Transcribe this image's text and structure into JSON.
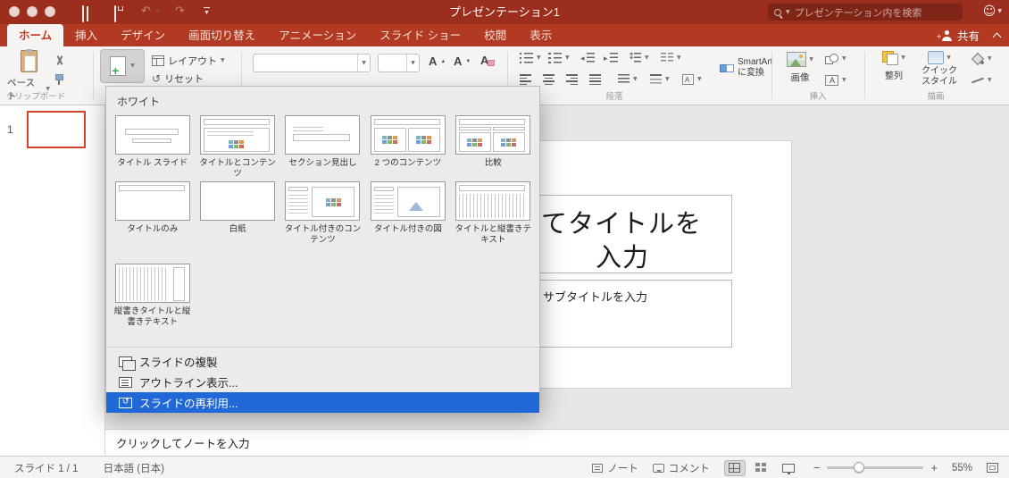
{
  "colors": {
    "titlebar": "#9c2e1e",
    "tabbar": "#b23a22",
    "tab_active_text": "#c03a22",
    "ribbon_bg": "#f5f4f3",
    "selection": "#2067d8",
    "slide_border": "#d2432c"
  },
  "titlebar": {
    "window_title": "プレゼンテーション1",
    "search_placeholder": "プレゼンテーション内を検索"
  },
  "tabs": [
    {
      "label": "ホーム",
      "active": true
    },
    {
      "label": "挿入"
    },
    {
      "label": "デザイン"
    },
    {
      "label": "画面切り替え"
    },
    {
      "label": "アニメーション"
    },
    {
      "label": "スライド ショー"
    },
    {
      "label": "校閲"
    },
    {
      "label": "表示"
    }
  ],
  "share": {
    "label": "共有"
  },
  "ribbon": {
    "paste": "ペースト",
    "clipboard_group": "クリップボード",
    "layout": "レイアウト",
    "reset": "リセット",
    "font_name_value": "",
    "font_size_value": "",
    "smartart_line1": "SmartArt",
    "smartart_line2": "に変換",
    "paragraph_group": "段落",
    "image": "画像",
    "insert_group": "挿入",
    "arrange": "整列",
    "quick_style_line1": "クイック",
    "quick_style_line2": "スタイル",
    "drawing_group": "描画"
  },
  "new_slide_menu": {
    "theme_header": "ホワイト",
    "layouts": [
      {
        "label": "タイトル スライド"
      },
      {
        "label": "タイトルとコンテンツ"
      },
      {
        "label": "セクション見出し"
      },
      {
        "label": "2 つのコンテンツ"
      },
      {
        "label": "比較"
      },
      {
        "label": "タイトルのみ"
      },
      {
        "label": "白紙"
      },
      {
        "label": "タイトル付きのコンテンツ"
      },
      {
        "label": "タイトル付きの図"
      },
      {
        "label": "タイトルと縦書きテキスト"
      },
      {
        "label": "縦書きタイトルと縦書きテキスト"
      }
    ],
    "commands": [
      {
        "label": "スライドの複製"
      },
      {
        "label": "アウトライン表示..."
      },
      {
        "label": "スライドの再利用...",
        "highlighted": true
      }
    ]
  },
  "slides_panel": {
    "slide_number": "1"
  },
  "slide": {
    "title_visible_line1": "てタイトルを",
    "title_visible_line2": "入力",
    "subtitle_visible": "サブタイトルを入力"
  },
  "notes": {
    "placeholder": "クリックしてノートを入力"
  },
  "statusbar": {
    "slide_counter": "スライド 1 / 1",
    "language": "日本語 (日本)",
    "notes": "ノート",
    "comments": "コメント",
    "zoom": "55%"
  }
}
